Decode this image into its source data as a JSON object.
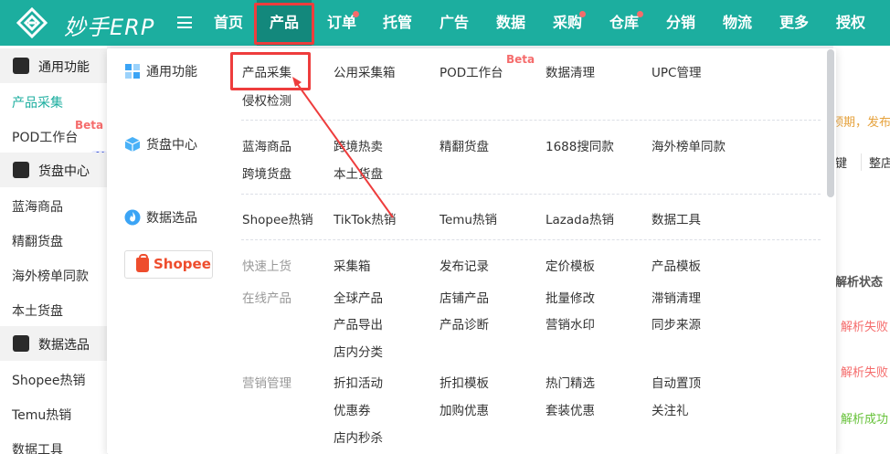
{
  "brand": {
    "name": "妙手ERP"
  },
  "nav": [
    {
      "label": "首页",
      "dot": false
    },
    {
      "label": "产品",
      "dot": false
    },
    {
      "label": "订单",
      "dot": true
    },
    {
      "label": "托管",
      "dot": false
    },
    {
      "label": "广告",
      "dot": false
    },
    {
      "label": "数据",
      "dot": false
    },
    {
      "label": "采购",
      "dot": true
    },
    {
      "label": "仓库",
      "dot": true
    },
    {
      "label": "分销",
      "dot": false
    },
    {
      "label": "物流",
      "dot": false
    },
    {
      "label": "更多",
      "dot": false
    },
    {
      "label": "授权",
      "dot": false
    }
  ],
  "sidebar": {
    "groups": [
      {
        "label": "通用功能",
        "icon": "grid-icon"
      },
      {
        "label": "货盘中心",
        "icon": "cube-icon"
      },
      {
        "label": "数据选品",
        "icon": "flame-icon"
      }
    ],
    "items": [
      "产品采集",
      "POD工作台",
      "蓝海商品",
      "精翻货盘",
      "海外榜单同款",
      "本土货盘",
      "Shopee热销",
      "Temu热销",
      "数据工具"
    ],
    "beta": "Beta",
    "ai": "AI"
  },
  "right_bg": {
    "notice": "预期，发布",
    "col1": "键",
    "col2": "整店",
    "status_header": "解析状态",
    "statuses": [
      "解析失败",
      "解析失败",
      "解析成功"
    ]
  },
  "menu": {
    "categories": [
      {
        "label": "通用功能",
        "icon": "grid-icon"
      },
      {
        "label": "货盘中心",
        "icon": "cube-icon"
      },
      {
        "label": "数据选品",
        "icon": "flame-icon"
      }
    ],
    "shopee": "Shopee",
    "general": [
      "产品采集",
      "公用采集箱",
      "POD工作台",
      "数据清理",
      "UPC管理",
      "侵权检测"
    ],
    "general_beta": "Beta",
    "supply": [
      "蓝海商品",
      "跨境热卖",
      "精翻货盘",
      "1688搜同款",
      "海外榜单同款",
      "跨境货盘",
      "本土货盘"
    ],
    "data": [
      "Shopee热销",
      "TikTok热销",
      "Temu热销",
      "Lazada热销",
      "数据工具"
    ],
    "shopee_sections": {
      "quick_label": "快速上货",
      "quick": [
        "采集箱",
        "发布记录",
        "定价模板",
        "产品模板"
      ],
      "online_label": "在线产品",
      "online": [
        "全球产品",
        "店铺产品",
        "批量修改",
        "滞销清理",
        "产品导出",
        "产品诊断",
        "营销水印",
        "同步来源",
        "店内分类"
      ],
      "marketing_label": "营销管理",
      "marketing": [
        "折扣活动",
        "折扣模板",
        "热门精选",
        "自动置顶",
        "优惠券",
        "加购优惠",
        "套装优惠",
        "关注礼",
        "店内秒杀"
      ]
    }
  },
  "colors": {
    "primary": "#1cae9f",
    "nav_active": "#13887c",
    "highlight": "#ee3d3d",
    "shopee": "#ee4d2d",
    "beta": "#f56c6c"
  }
}
